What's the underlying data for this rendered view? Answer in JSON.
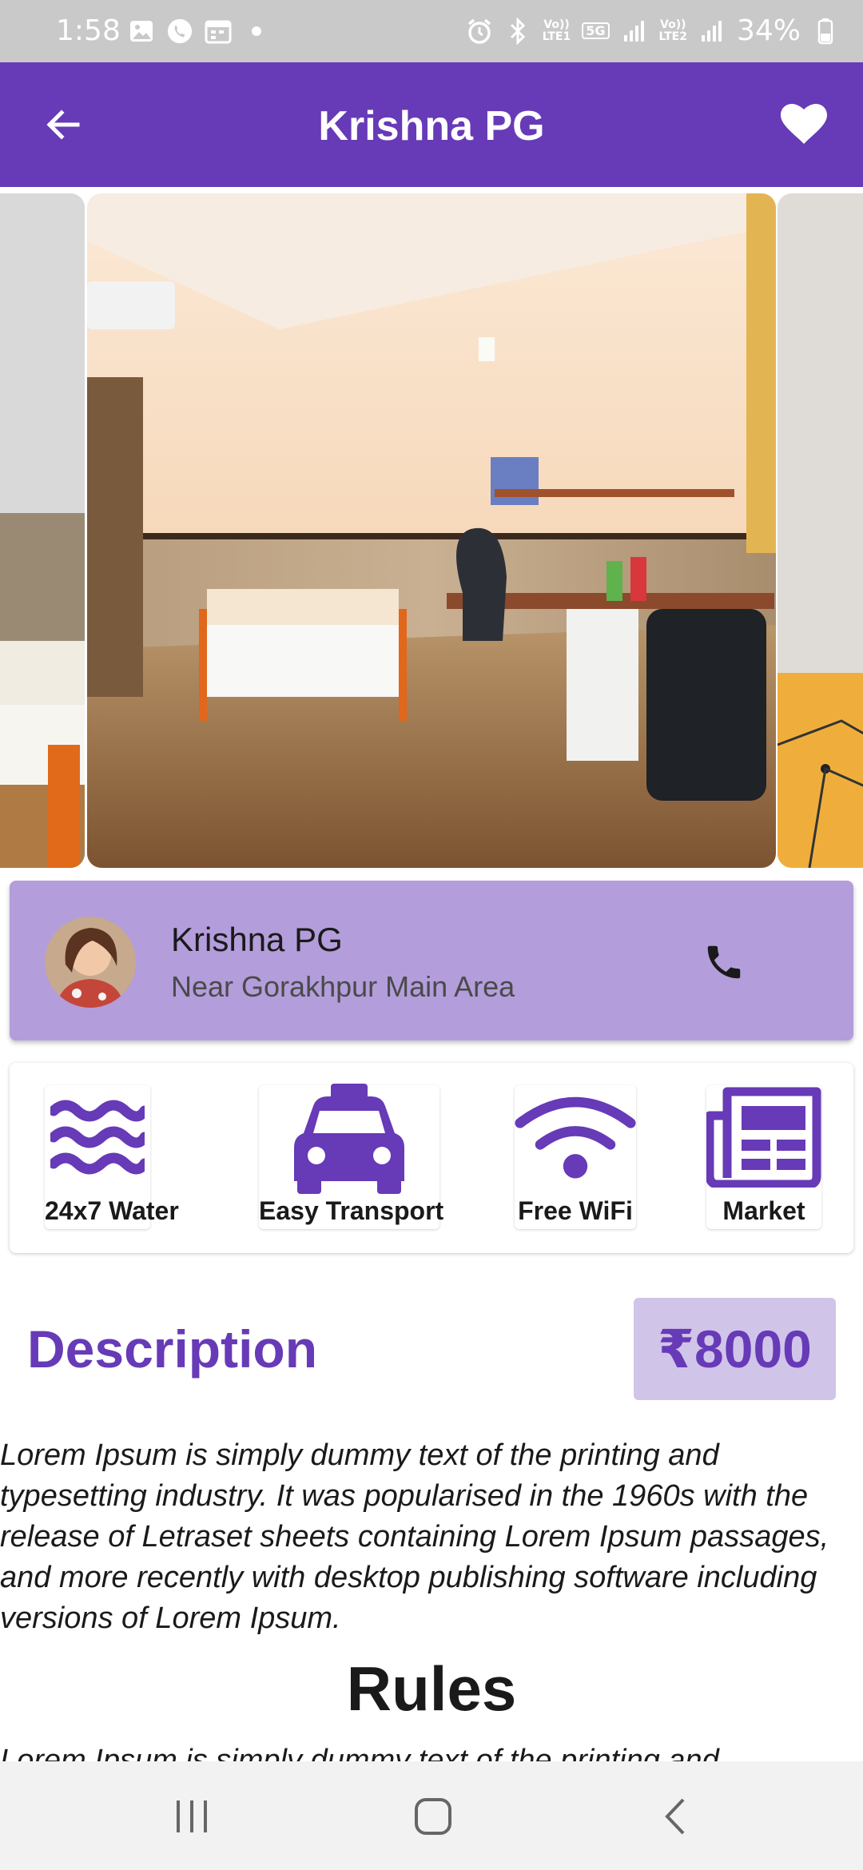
{
  "status_bar": {
    "time": "1:58",
    "battery": "34%",
    "net1_line1": "Vo))",
    "net1_line2": "LTE1",
    "net_type": "5G",
    "net2_line1": "Vo))",
    "net2_line2": "LTE2",
    "left_icons": [
      "gallery-icon",
      "whatsapp-icon",
      "calendar-icon",
      "dot-icon"
    ],
    "right_icons": [
      "alarm-icon",
      "bluetooth-icon",
      "signal-icon",
      "battery-icon"
    ]
  },
  "app_bar": {
    "title": "Krishna PG",
    "back_icon": "arrow-back-icon",
    "fav_icon": "heart-icon",
    "color": "#673ab7"
  },
  "carousel": {
    "images": [
      "room-photo-prev",
      "room-photo-main",
      "room-photo-next"
    ]
  },
  "owner": {
    "name": "Krishna PG",
    "location": "Near Gorakhpur Main Area",
    "call_icon": "phone-icon",
    "card_color": "#b39ddb"
  },
  "amenities": [
    {
      "label": "24x7 Water",
      "icon": "water-waves-icon"
    },
    {
      "label": "Easy Transport",
      "icon": "taxi-icon"
    },
    {
      "label": "Free WiFi",
      "icon": "wifi-icon"
    },
    {
      "label": "Market",
      "icon": "newspaper-icon"
    }
  ],
  "description": {
    "heading": "Description",
    "price": "₹8000",
    "text": "Lorem Ipsum is simply dummy text of the printing and typesetting industry. It was popularised in the 1960s with the release of Letraset sheets containing Lorem Ipsum passages, and more recently with desktop publishing software including versions of Lorem Ipsum."
  },
  "rules": {
    "heading": "Rules",
    "text": "Lorem Ipsum is simply dummy text of the printing and"
  },
  "nav_bar": {
    "icons": [
      "recent-apps-icon",
      "home-icon",
      "back-icon"
    ]
  }
}
